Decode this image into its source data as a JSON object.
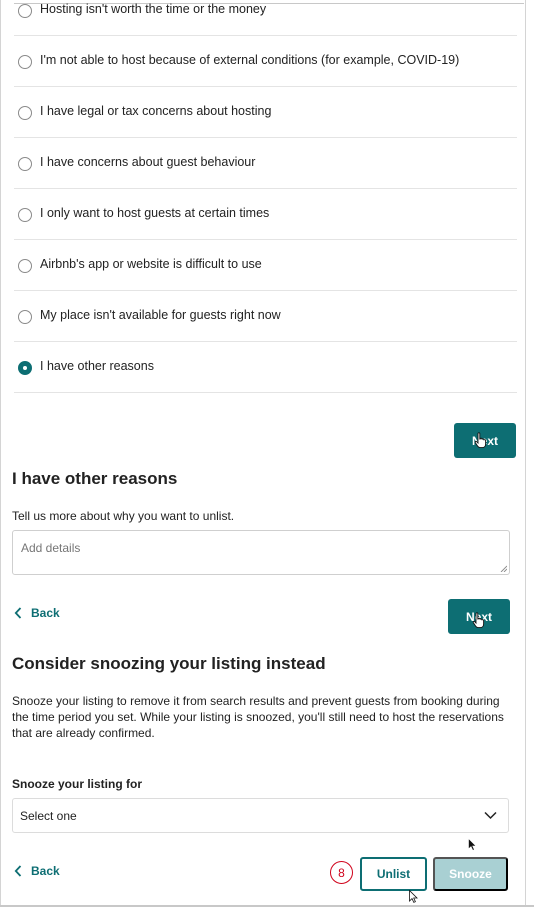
{
  "reasons": {
    "options": [
      {
        "label": "Hosting isn't worth the time or the money",
        "checked": false
      },
      {
        "label": "I'm not able to host because of external conditions (for example, COVID-19)",
        "checked": false
      },
      {
        "label": "I have legal or tax concerns about hosting",
        "checked": false
      },
      {
        "label": "I have concerns about guest behaviour",
        "checked": false
      },
      {
        "label": "I only want to host guests at certain times",
        "checked": false
      },
      {
        "label": "Airbnb's app or website is difficult to use",
        "checked": false
      },
      {
        "label": "My place isn't available for guests right now",
        "checked": false
      },
      {
        "label": "I have other reasons",
        "checked": true
      }
    ],
    "next_label": "Next"
  },
  "other_reasons": {
    "title": "I have other reasons",
    "prompt": "Tell us more about why you want to unlist.",
    "details_placeholder": "Add details",
    "back_label": "Back",
    "next_label": "Next"
  },
  "snooze": {
    "title": "Consider snoozing your listing instead",
    "description": "Snooze your listing to remove it from search results and prevent guests from booking during the time period you set. While your listing is snoozed, you'll still need to host the reservations that are already confirmed.",
    "duration_label": "Snooze your listing for",
    "duration_value": "Select one",
    "back_label": "Back",
    "unlist_label": "Unlist",
    "snooze_label": "Snooze"
  },
  "annotation": {
    "step_number": "8",
    "color": "#d0021b"
  },
  "colors": {
    "accent": "#0d6e73",
    "disabled_accent": "#a9d0d3",
    "text": "#222222",
    "divider": "#e4e4e4"
  },
  "icons": {
    "back": "chevron-left-icon",
    "select": "chevron-down-icon",
    "cursor_hand": "hand-pointer-icon",
    "cursor_arrow": "arrow-pointer-icon"
  }
}
